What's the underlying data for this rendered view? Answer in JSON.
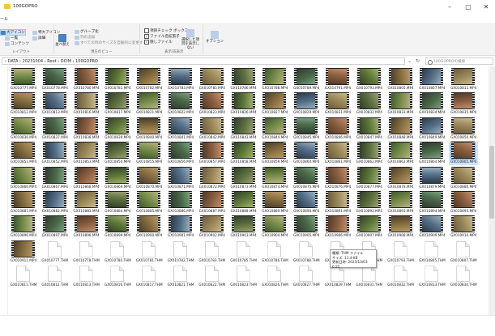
{
  "window": {
    "title": "100GOPRO",
    "minimize": "–",
    "maximize": "□",
    "close": "✕"
  },
  "menu": {
    "file": "ール"
  },
  "ribbon": {
    "layout": {
      "xl_icons": "大アイコン",
      "l_icons": "特大アイコン",
      "small": "一覧",
      "details": "詳細",
      "content": "コンテンツ",
      "group": "レイアウト"
    },
    "view": {
      "sort": "並べ替え",
      "group_by": "グループ化",
      "add_col": "列の追加",
      "fit_col": "すべての列のサイズを自動的に変更する",
      "group": "現在のビュー"
    },
    "show": {
      "item_check": "項目チェック ボックス",
      "ext": "ファイル名拡張子",
      "hidden": "隠しファイル",
      "hide_sel": "選択した項目を表示しない",
      "group": "表示/非表示"
    },
    "options": "オプション"
  },
  "address": {
    "path": "›  DATA  ›  20231004  ›  Root  ›  DCIM  ›  100GOPRO",
    "refresh": "↻",
    "dropdown": "⌄",
    "search_placeholder": "100GOPROの検索"
  },
  "tooltip": {
    "line1": "種類: THM ファイル",
    "line2": "サイズ: 11.4 KB",
    "line3": "更新日時: 2023/10/03 0:25"
  },
  "colors": {
    "accent": "#0078d4",
    "selection": "#cce5fb"
  },
  "files": [
    {
      "name": "GX010777.MP4",
      "kind": "video"
    },
    {
      "name": "GX010778.MP4",
      "kind": "video"
    },
    {
      "name": "GX010780.MP4",
      "kind": "video"
    },
    {
      "name": "GX010781.MP4",
      "kind": "video"
    },
    {
      "name": "GX010782.MP4",
      "kind": "video"
    },
    {
      "name": "GX010783.MP4",
      "kind": "video"
    },
    {
      "name": "GX010785.MP4",
      "kind": "video"
    },
    {
      "name": "GX010786.MP4",
      "kind": "video"
    },
    {
      "name": "GX010788.MP4",
      "kind": "video"
    },
    {
      "name": "GX010789.MP4",
      "kind": "video"
    },
    {
      "name": "GX010791.MP4",
      "kind": "video"
    },
    {
      "name": "GX010793.MP4",
      "kind": "video"
    },
    {
      "name": "GX010805.MP4",
      "kind": "video"
    },
    {
      "name": "GX010807.MP4",
      "kind": "video"
    },
    {
      "name": "GX010811.MP4",
      "kind": "video"
    },
    {
      "name": "GX010812.MP4",
      "kind": "video"
    },
    {
      "name": "GX010813.MP4",
      "kind": "video"
    },
    {
      "name": "GX010816.MP4",
      "kind": "video"
    },
    {
      "name": "GX010817.MP4",
      "kind": "video"
    },
    {
      "name": "GX010821.MP4",
      "kind": "video"
    },
    {
      "name": "GX010822.MP4",
      "kind": "video"
    },
    {
      "name": "GX010823.MP4",
      "kind": "video"
    },
    {
      "name": "GX010826.MP4",
      "kind": "video"
    },
    {
      "name": "GX010827.MP4",
      "kind": "video"
    },
    {
      "name": "GX010829.MP4",
      "kind": "video"
    },
    {
      "name": "GX010831.MP4",
      "kind": "video"
    },
    {
      "name": "GX010832.MP4",
      "kind": "video"
    },
    {
      "name": "GX010833.MP4",
      "kind": "video"
    },
    {
      "name": "GX010834.MP4",
      "kind": "video"
    },
    {
      "name": "GX010835.MP4",
      "kind": "video"
    },
    {
      "name": "GX010836.MP4",
      "kind": "video"
    },
    {
      "name": "GX010837.MP4",
      "kind": "video"
    },
    {
      "name": "GX010838.MP4",
      "kind": "video"
    },
    {
      "name": "GX010839.MP4",
      "kind": "video"
    },
    {
      "name": "GX010840.MP4",
      "kind": "video"
    },
    {
      "name": "GX010841.MP4",
      "kind": "video"
    },
    {
      "name": "GX010842.MP4",
      "kind": "video"
    },
    {
      "name": "GX010843.MP4",
      "kind": "video"
    },
    {
      "name": "GX010844.MP4",
      "kind": "video"
    },
    {
      "name": "GX010845.MP4",
      "kind": "video"
    },
    {
      "name": "GX010846.MP4",
      "kind": "video"
    },
    {
      "name": "GX010847.MP4",
      "kind": "video"
    },
    {
      "name": "GX010848.MP4",
      "kind": "video"
    },
    {
      "name": "GX010849.MP4",
      "kind": "video"
    },
    {
      "name": "GX010850.MP4",
      "kind": "video"
    },
    {
      "name": "GX010851.MP4",
      "kind": "video"
    },
    {
      "name": "GX010852.MP4",
      "kind": "video"
    },
    {
      "name": "GX010853.MP4",
      "kind": "video"
    },
    {
      "name": "GX010854.MP4",
      "kind": "video"
    },
    {
      "name": "GX010855.MP4",
      "kind": "video"
    },
    {
      "name": "GX010856.MP4",
      "kind": "video"
    },
    {
      "name": "GX010857.MP4",
      "kind": "video"
    },
    {
      "name": "GX010858.MP4",
      "kind": "video"
    },
    {
      "name": "GX010859.MP4",
      "kind": "video"
    },
    {
      "name": "GX010860.MP4",
      "kind": "video"
    },
    {
      "name": "GX010861.MP4",
      "kind": "video"
    },
    {
      "name": "GX010862.MP4",
      "kind": "video"
    },
    {
      "name": "GX010863.MP4",
      "kind": "video"
    },
    {
      "name": "GX010864.MP4",
      "kind": "video"
    },
    {
      "name": "GX010865.MP4",
      "kind": "video",
      "selected": true
    },
    {
      "name": "GX010866.MP4",
      "kind": "video"
    },
    {
      "name": "GX010867.MP4",
      "kind": "video"
    },
    {
      "name": "GX010868.MP4",
      "kind": "video"
    },
    {
      "name": "GX010869.MP4",
      "kind": "video"
    },
    {
      "name": "GX010870.MP4",
      "kind": "video"
    },
    {
      "name": "GX010871.MP4",
      "kind": "video"
    },
    {
      "name": "GX010872.MP4",
      "kind": "video"
    },
    {
      "name": "GX010873.MP4",
      "kind": "video"
    },
    {
      "name": "GX010874.MP4",
      "kind": "video"
    },
    {
      "name": "GX010875.MP4",
      "kind": "video"
    },
    {
      "name": "GX010876.MP4",
      "kind": "video"
    },
    {
      "name": "GX010877.MP4",
      "kind": "video"
    },
    {
      "name": "GX010878.MP4",
      "kind": "video"
    },
    {
      "name": "GX010879.MP4",
      "kind": "video"
    },
    {
      "name": "GX010880.MP4",
      "kind": "video"
    },
    {
      "name": "GX010881.MP4",
      "kind": "video"
    },
    {
      "name": "GX010882.MP4",
      "kind": "video"
    },
    {
      "name": "GX010883.MP4",
      "kind": "video"
    },
    {
      "name": "GX010884.MP4",
      "kind": "video"
    },
    {
      "name": "GX010885.MP4",
      "kind": "video"
    },
    {
      "name": "GX010886.MP4",
      "kind": "video"
    },
    {
      "name": "GX010887.MP4",
      "kind": "video"
    },
    {
      "name": "GX010888.MP4",
      "kind": "video"
    },
    {
      "name": "GX010889.MP4",
      "kind": "video"
    },
    {
      "name": "GX010890.MP4",
      "kind": "video"
    },
    {
      "name": "GX010891.MP4",
      "kind": "video"
    },
    {
      "name": "GX010892.MP4",
      "kind": "video"
    },
    {
      "name": "GX010893.MP4",
      "kind": "video"
    },
    {
      "name": "GX010894.MP4",
      "kind": "video"
    },
    {
      "name": "GX010895.MP4",
      "kind": "video"
    },
    {
      "name": "GX010896.MP4",
      "kind": "video"
    },
    {
      "name": "GX010897.MP4",
      "kind": "video"
    },
    {
      "name": "GX010898.MP4",
      "kind": "video"
    },
    {
      "name": "GX010899.MP4",
      "kind": "video"
    },
    {
      "name": "GX010900.MP4",
      "kind": "video"
    },
    {
      "name": "GX010901.MP4",
      "kind": "video"
    },
    {
      "name": "GX010902.MP4",
      "kind": "video"
    },
    {
      "name": "GX010903.MP4",
      "kind": "video"
    },
    {
      "name": "GX010904.MP4",
      "kind": "video"
    },
    {
      "name": "GX010905.MP4",
      "kind": "video"
    },
    {
      "name": "GX010906.MP4",
      "kind": "video"
    },
    {
      "name": "GX010907.MP4",
      "kind": "video"
    },
    {
      "name": "GX010908.MP4",
      "kind": "video"
    },
    {
      "name": "GX010909.MP4",
      "kind": "video"
    },
    {
      "name": "GX010910.MP4",
      "kind": "video"
    },
    {
      "name": "GX010911.MP4",
      "kind": "video"
    },
    {
      "name": "GX010777.THM",
      "kind": "doc"
    },
    {
      "name": "GX010778.THM",
      "kind": "doc"
    },
    {
      "name": "GX010780.THM",
      "kind": "doc"
    },
    {
      "name": "GX010781.THM",
      "kind": "doc"
    },
    {
      "name": "GX010782.THM",
      "kind": "doc"
    },
    {
      "name": "GX010783.THM",
      "kind": "doc"
    },
    {
      "name": "GX010785.THM",
      "kind": "doc"
    },
    {
      "name": "GX010786.THM",
      "kind": "doc"
    },
    {
      "name": "GX010788.THM",
      "kind": "doc"
    },
    {
      "name": "GX010789.THM",
      "kind": "doc"
    },
    {
      "name": "GX010791.THM",
      "kind": "doc"
    },
    {
      "name": "GX010793.THM",
      "kind": "doc"
    },
    {
      "name": "GX010805.THM",
      "kind": "doc"
    },
    {
      "name": "GX010807.THM",
      "kind": "doc"
    },
    {
      "name": "GX010811.THM",
      "kind": "doc"
    },
    {
      "name": "GX010812.THM",
      "kind": "doc"
    },
    {
      "name": "GX010813.THM",
      "kind": "doc"
    },
    {
      "name": "GX010816.THM",
      "kind": "doc"
    },
    {
      "name": "GX010817.THM",
      "kind": "doc"
    },
    {
      "name": "GX010821.THM",
      "kind": "doc"
    },
    {
      "name": "GX010822.THM",
      "kind": "doc"
    },
    {
      "name": "GX010823.THM",
      "kind": "doc"
    },
    {
      "name": "GX010826.THM",
      "kind": "doc"
    },
    {
      "name": "GX010827.THM",
      "kind": "doc"
    },
    {
      "name": "GX010829.THM",
      "kind": "doc"
    },
    {
      "name": "GX010831.THM",
      "kind": "doc"
    },
    {
      "name": "GX010832.THM",
      "kind": "doc"
    },
    {
      "name": "GX010833.THM",
      "kind": "doc"
    },
    {
      "name": "GX010834.THM",
      "kind": "doc"
    }
  ]
}
